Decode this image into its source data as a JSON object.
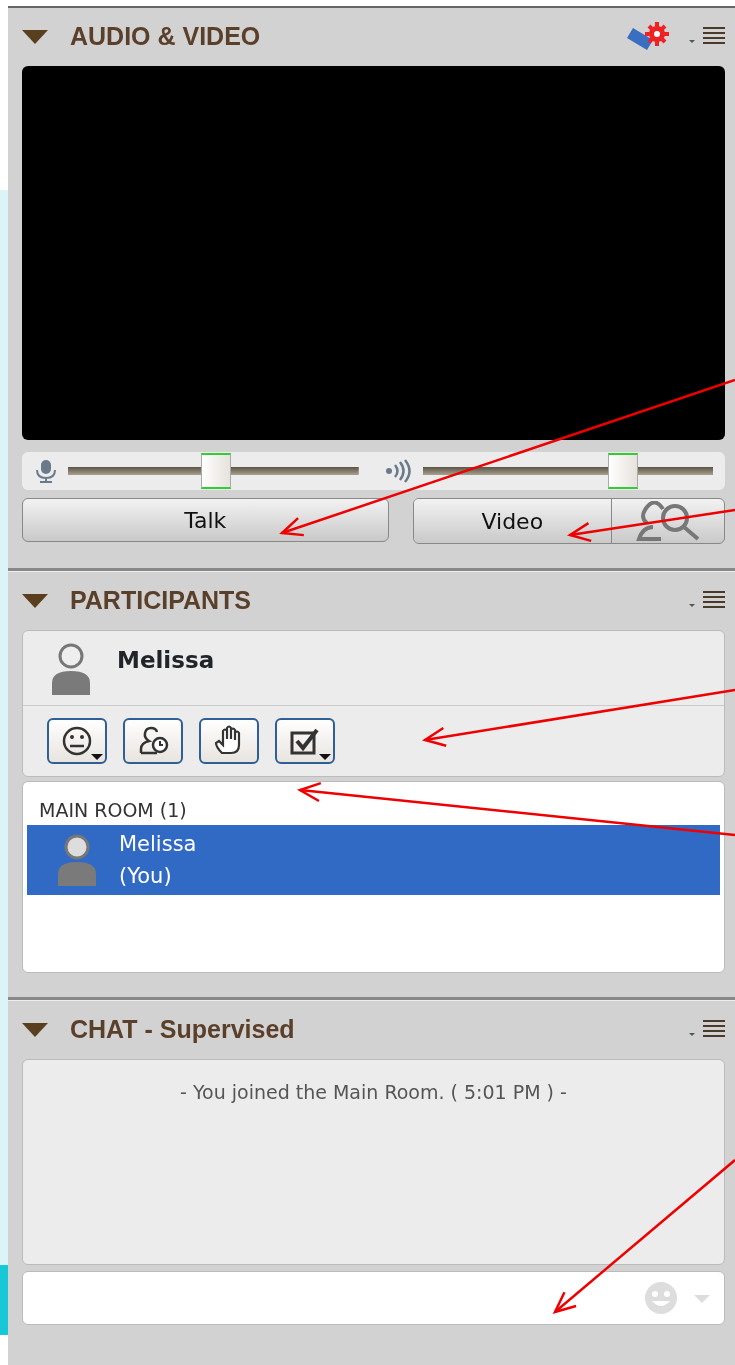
{
  "audio_video": {
    "title": "AUDIO & VIDEO",
    "expanded": true,
    "sliders": [
      {
        "kind": "microphone",
        "level": 0.51
      },
      {
        "kind": "speaker",
        "level": 0.69
      }
    ],
    "buttons": [
      {
        "label": "Talk"
      },
      {
        "label": "Video"
      }
    ]
  },
  "participants": {
    "title": "PARTICIPANTS",
    "expanded": true,
    "me": {
      "name": "Melissa"
    },
    "status_buttons": [
      {
        "kind": "emoticon",
        "dropdown": true
      },
      {
        "kind": "away",
        "dropdown": false
      },
      {
        "kind": "hand",
        "dropdown": false
      },
      {
        "kind": "check",
        "dropdown": true
      }
    ],
    "room": {
      "label": "MAIN ROOM (1)",
      "members": [
        {
          "name": "Melissa",
          "note": "(You)",
          "selected": true
        }
      ]
    }
  },
  "chat": {
    "title": "CHAT - Supervised",
    "expanded": true,
    "messages": [
      {
        "text": "- You joined the Main Room. ( 5:01 PM ) -"
      }
    ]
  }
}
